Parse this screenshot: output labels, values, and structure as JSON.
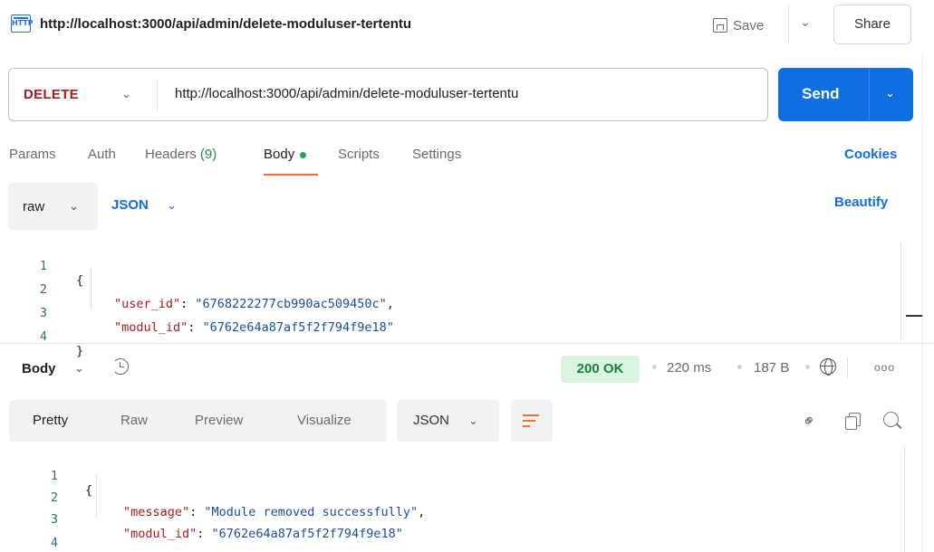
{
  "header": {
    "icon": "HTTP",
    "title": "http://localhost:3000/api/admin/delete-moduluser-tertentu",
    "save_label": "Save",
    "share_label": "Share"
  },
  "request": {
    "method": "DELETE",
    "url": "http://localhost:3000/api/admin/delete-moduluser-tertentu",
    "send_label": "Send"
  },
  "tabs": [
    {
      "label": "Params"
    },
    {
      "label": "Auth"
    },
    {
      "label": "Headers",
      "count": "(9)"
    },
    {
      "label": "Body"
    },
    {
      "label": "Scripts"
    },
    {
      "label": "Settings"
    }
  ],
  "cookies_label": "Cookies",
  "body_toolbar": {
    "mode": "raw",
    "format": "JSON",
    "beautify_label": "Beautify"
  },
  "request_body": {
    "line_numbers": [
      "1",
      "2",
      "3",
      "4"
    ],
    "open_brace": "{",
    "close_brace": "}",
    "fields": [
      {
        "key": "\"user_id\"",
        "value": "\"6768222277cb990ac509450c\"",
        "trail": ","
      },
      {
        "key": "\"modul_id\"",
        "value": "\"6762e64a87af5f2f794f9e18\"",
        "trail": ""
      }
    ]
  },
  "response": {
    "label": "Body",
    "status": "200 OK",
    "time": "220 ms",
    "size": "187 B",
    "more": "ooo",
    "view_tabs": [
      "Pretty",
      "Raw",
      "Preview",
      "Visualize"
    ],
    "format": "JSON",
    "line_numbers": [
      "1",
      "2",
      "3",
      "4"
    ],
    "open_brace": "{",
    "close_brace": "}",
    "fields": [
      {
        "key": "\"message\"",
        "value": "\"Module removed successfully\"",
        "trail": ","
      },
      {
        "key": "\"modul_id\"",
        "value": "\"6762e64a87af5f2f794f9e18\"",
        "trail": ""
      }
    ]
  },
  "colors": {
    "accent": "#0f6ee0",
    "method": "#a61c1c",
    "status_bg": "#d9f5e1",
    "status_text": "#1b7f3b",
    "active_tab_underline": "#f26b3a"
  }
}
